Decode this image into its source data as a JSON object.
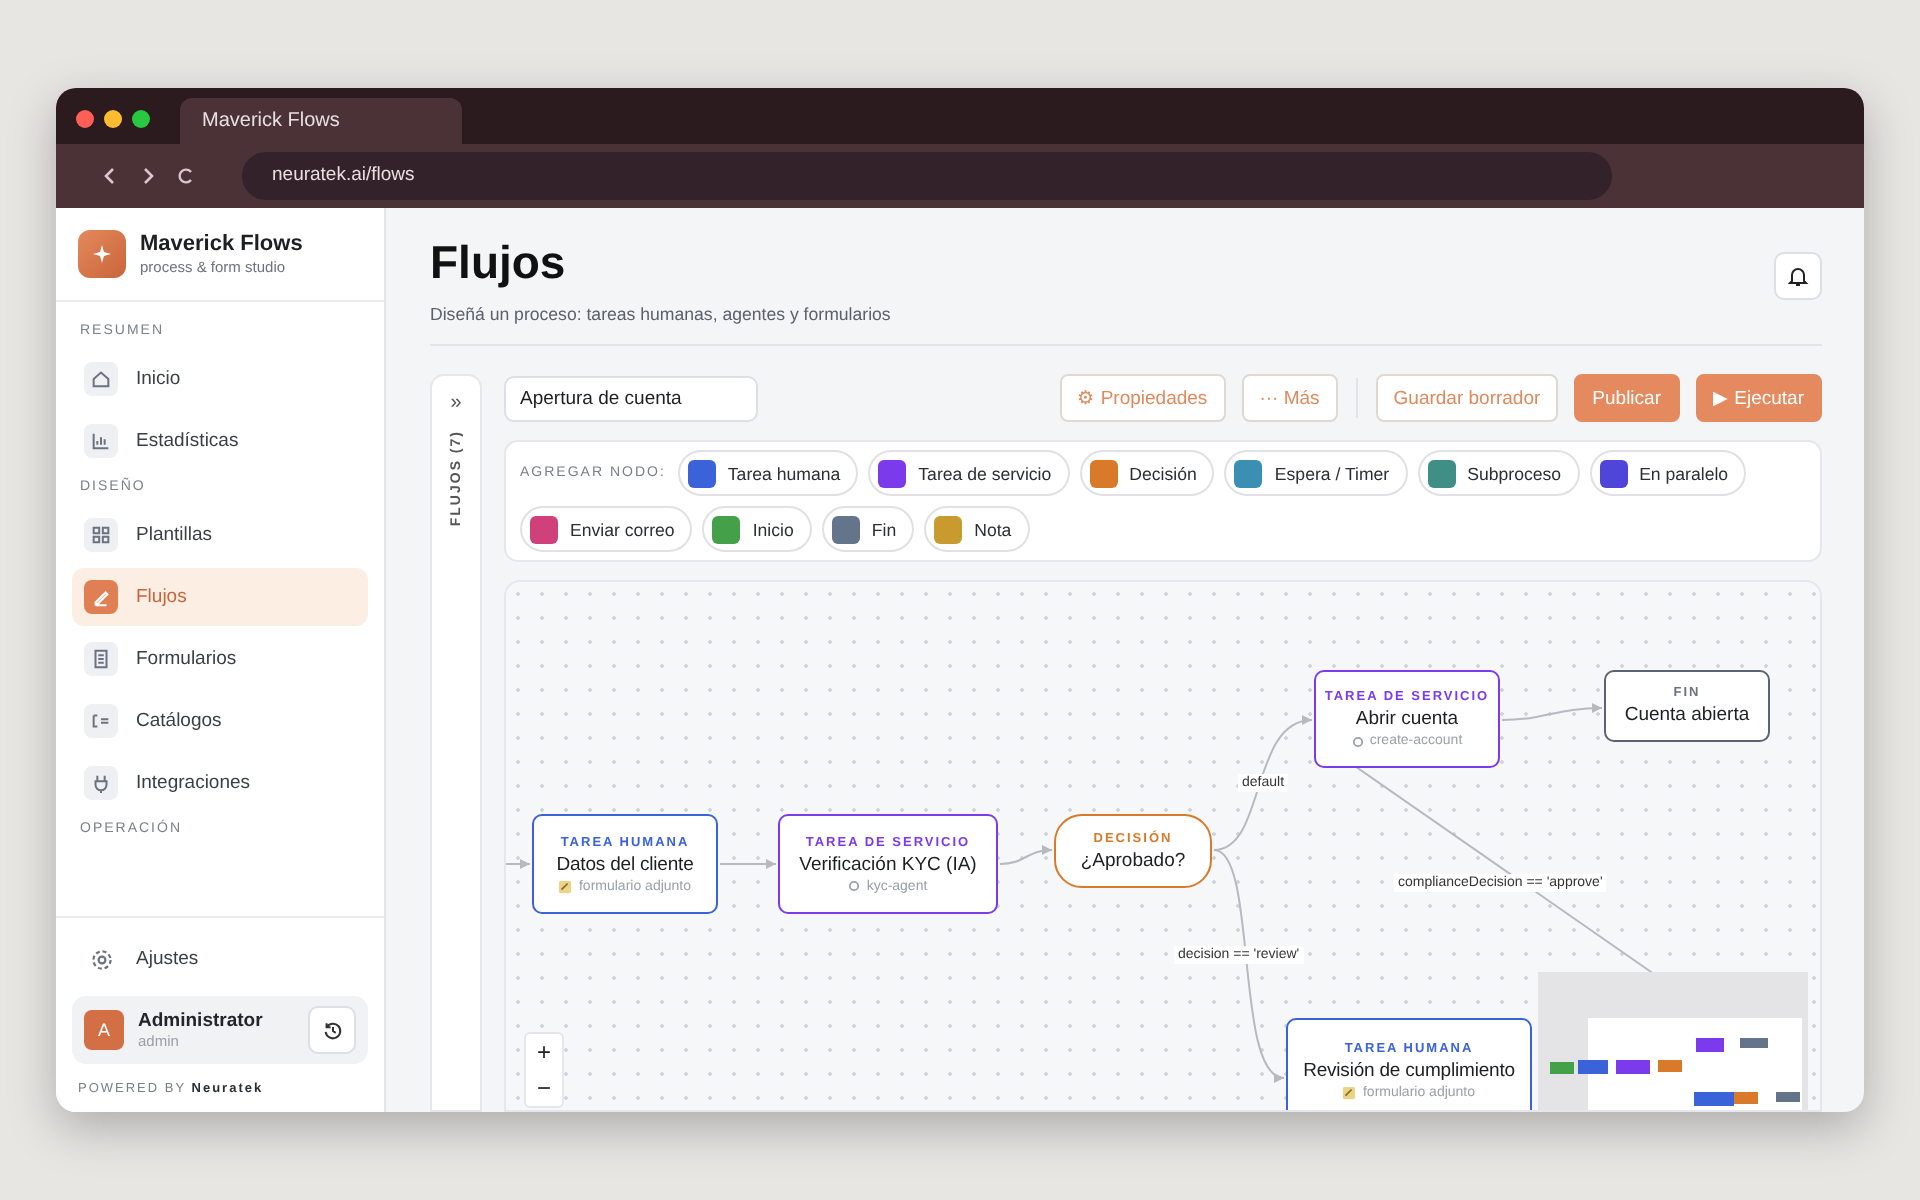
{
  "browser": {
    "tab_title": "Maverick Flows",
    "url": "neuratek.ai/flows"
  },
  "brand": {
    "name": "Maverick Flows",
    "tagline": "process & form studio"
  },
  "sidebar": {
    "sections": [
      {
        "heading": "RESUMEN",
        "items": [
          {
            "label": "Inicio",
            "selected": false
          },
          {
            "label": "Estadísticas",
            "selected": false
          }
        ]
      },
      {
        "heading": "DISEÑO",
        "items": [
          {
            "label": "Plantillas",
            "selected": false
          },
          {
            "label": "Flujos",
            "selected": true
          },
          {
            "label": "Formularios",
            "selected": false
          },
          {
            "label": "Catálogos",
            "selected": false
          },
          {
            "label": "Integraciones",
            "selected": false
          }
        ]
      },
      {
        "heading": "OPERACIÓN"
      }
    ]
  },
  "settings": {
    "label": "Ajustes"
  },
  "user": {
    "initial": "A",
    "name": "Administrator",
    "role": "admin"
  },
  "powered_by": {
    "prefix": "POWERED BY",
    "brand": "Neuratek"
  },
  "page": {
    "title": "Flujos",
    "subtitle": "Diseñá un proceso: tareas humanas, agentes y formularios"
  },
  "flows_rail": {
    "toggle": "»",
    "label": "FLUJOS (7)"
  },
  "toolbar": {
    "flow_name": "Apertura de cuenta",
    "buttons": [
      {
        "label": "⚙ Propiedades",
        "kind": "outline"
      },
      {
        "label": "··· Más",
        "kind": "outline"
      },
      {
        "label": "Guardar borrador",
        "kind": "outline"
      },
      {
        "label": "Publicar",
        "kind": "primary"
      },
      {
        "label": "▶ Ejecutar",
        "kind": "primary"
      }
    ]
  },
  "palette": {
    "label": "AGREGAR NODO:",
    "items": [
      {
        "label": "Tarea humana",
        "color": "#3b63d9"
      },
      {
        "label": "Tarea de servicio",
        "color": "#7c3aed"
      },
      {
        "label": "Decisión",
        "color": "#d97a2b"
      },
      {
        "label": "Espera / Timer",
        "color": "#3b8fb3"
      },
      {
        "label": "Subproceso",
        "color": "#3f8f86"
      },
      {
        "label": "En paralelo",
        "color": "#4f46d9"
      },
      {
        "label": "Enviar correo",
        "color": "#d0407a"
      },
      {
        "label": "Inicio",
        "color": "#45a04a"
      },
      {
        "label": "Fin",
        "color": "#64748b"
      },
      {
        "label": "Nota",
        "color": "#c99a2e"
      }
    ]
  },
  "canvas": {
    "nodes": [
      {
        "kind": "human",
        "type_label": "TAREA HUMANA",
        "title": "Datos del cliente",
        "detail": "formulario adjunto"
      },
      {
        "kind": "service",
        "type_label": "TAREA DE SERVICIO",
        "title": "Verificación KYC (IA)",
        "detail": "kyc-agent"
      },
      {
        "kind": "decision",
        "type_label": "DECISIÓN",
        "title": "¿Aprobado?"
      },
      {
        "kind": "service",
        "type_label": "TAREA DE SERVICIO",
        "title": "Abrir cuenta",
        "detail": "create-account"
      },
      {
        "kind": "end",
        "type_label": "FIN",
        "title": "Cuenta abierta"
      },
      {
        "kind": "human",
        "type_label": "TAREA HUMANA",
        "title": "Revisión de cumplimiento",
        "detail": "formulario adjunto"
      }
    ],
    "edge_labels": [
      "default",
      "complianceDecision == 'approve'",
      "decision == 'review'"
    ],
    "zoom_controls": [
      "+",
      "−"
    ]
  }
}
